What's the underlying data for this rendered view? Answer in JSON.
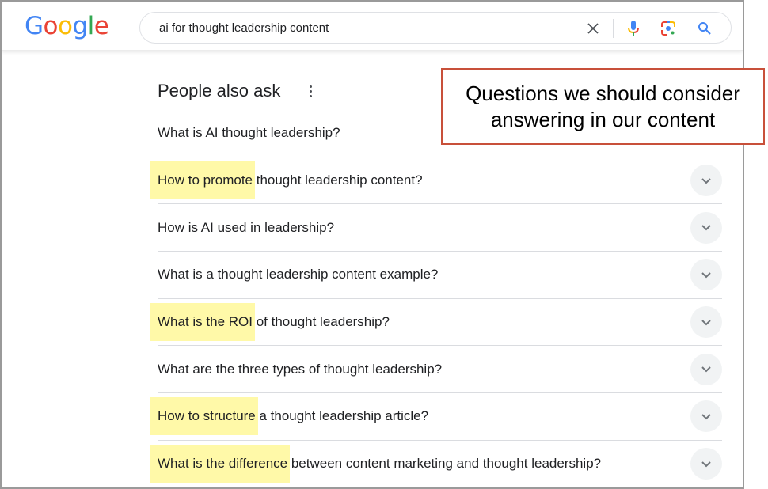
{
  "header": {
    "logo": {
      "letters": [
        "G",
        "o",
        "o",
        "g",
        "l",
        "e"
      ],
      "colors": [
        "#4285F4",
        "#EA4335",
        "#FBBC05",
        "#4285F4",
        "#34A853",
        "#EA4335"
      ]
    },
    "search": {
      "query": "ai for thought leadership content",
      "icons": [
        "clear-icon",
        "mic-icon",
        "lens-icon",
        "search-icon"
      ]
    }
  },
  "paa": {
    "title": "People also ask",
    "menu_icon": "more-vert-icon",
    "questions": [
      {
        "highlight": "",
        "rest": "What is AI thought leadership?",
        "expandable": false
      },
      {
        "highlight": "How to promote",
        "rest": " thought leadership content?",
        "expandable": true
      },
      {
        "highlight": "",
        "rest": "How is AI used in leadership?",
        "expandable": true
      },
      {
        "highlight": "",
        "rest": "What is a thought leadership content example?",
        "expandable": true
      },
      {
        "highlight": "What is the ROI",
        "rest": " of thought leadership?",
        "expandable": true
      },
      {
        "highlight": "",
        "rest": "What are the three types of thought leadership?",
        "expandable": true
      },
      {
        "highlight": "How to structure",
        "rest": " a thought leadership article?",
        "expandable": true
      },
      {
        "highlight": "What is the difference",
        "rest": " between content marketing and thought leadership?",
        "expandable": true
      }
    ]
  },
  "annotation": {
    "line1": "Questions we should consider",
    "line2": "answering in our content",
    "border_color": "#c8503a",
    "highlight_color": "#fff9a8"
  }
}
